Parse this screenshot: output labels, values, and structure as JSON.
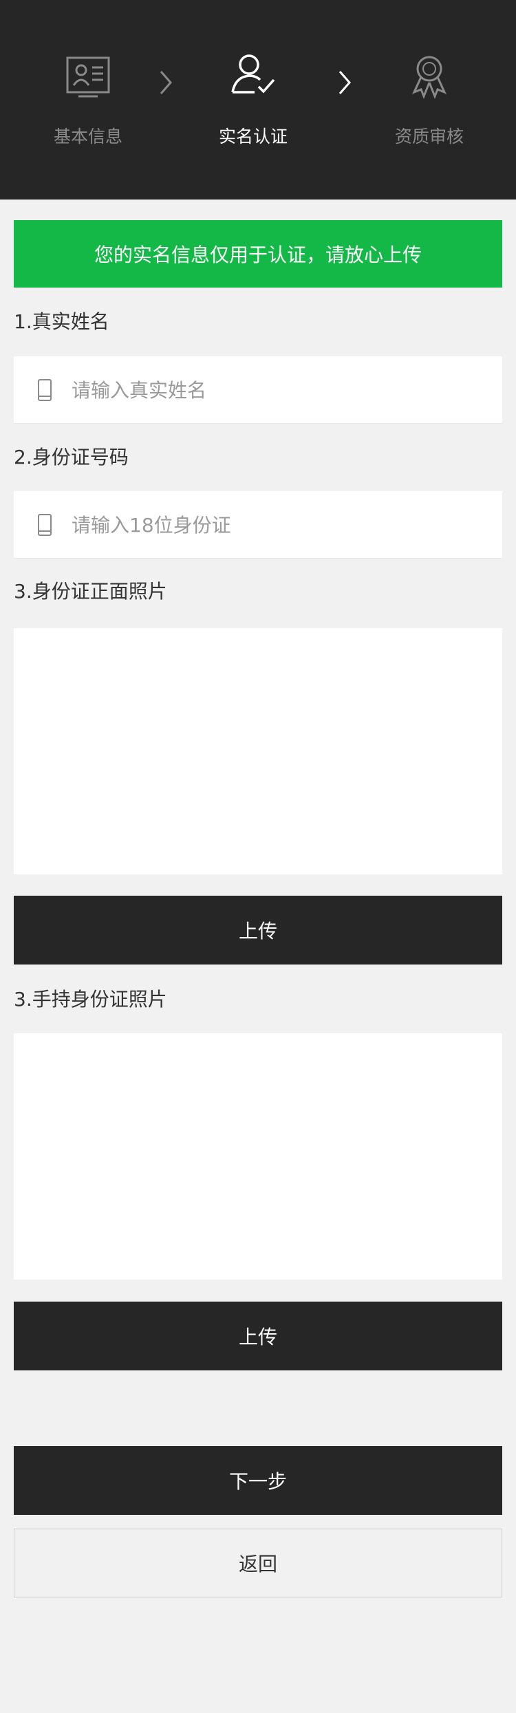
{
  "steps": [
    {
      "label": "基本信息",
      "icon": "id-card-icon",
      "state": "done"
    },
    {
      "label": "实名认证",
      "icon": "user-check-icon",
      "state": "active"
    },
    {
      "label": "资质审核",
      "icon": "award-ribbon-icon",
      "state": "pending"
    }
  ],
  "notice": "您的实名信息仅用于认证，请放心上传",
  "sections": {
    "name_title": "1.真实姓名",
    "name_placeholder": "请输入真实姓名",
    "id_title": "2.身份证号码",
    "id_placeholder": "请输入18位身份证",
    "front_photo_title": "3.身份证正面照片",
    "handheld_photo_title": "3.手持身份证照片"
  },
  "buttons": {
    "upload_front": "上传",
    "upload_handheld": "上传",
    "next": "下一步",
    "back": "返回"
  },
  "colors": {
    "header_bg": "#262626",
    "notice_bg": "#13b846",
    "page_bg": "#f1f1f1"
  }
}
